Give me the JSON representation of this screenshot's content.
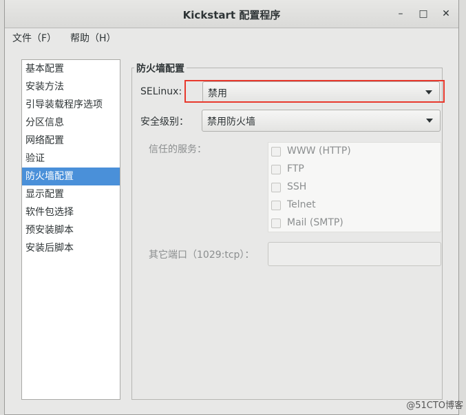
{
  "window": {
    "title": "Kickstart 配置程序",
    "controls": {
      "minimize": "–",
      "maximize": "□",
      "close": "✕"
    }
  },
  "menubar": {
    "items": [
      "文件（F）",
      "帮助（H）"
    ]
  },
  "sidebar": {
    "items": [
      "基本配置",
      "安装方法",
      "引导装载程序选项",
      "分区信息",
      "网络配置",
      "验证",
      "防火墙配置",
      "显示配置",
      "软件包选择",
      "预安装脚本",
      "安装后脚本"
    ],
    "active_index": 6
  },
  "firewall": {
    "section_title": "防火墙配置",
    "selinux": {
      "label": "SELinux:",
      "value": "禁用"
    },
    "security_level": {
      "label": "安全级别：",
      "value": "禁用防火墙"
    },
    "trusted_services": {
      "label": "信任的服务：",
      "items": [
        {
          "label": "WWW (HTTP)",
          "checked": false
        },
        {
          "label": "FTP",
          "checked": false
        },
        {
          "label": "SSH",
          "checked": false
        },
        {
          "label": "Telnet",
          "checked": false
        },
        {
          "label": "Mail (SMTP)",
          "checked": false
        }
      ]
    },
    "other_ports": {
      "label": "其它端口（1029:tcp）：",
      "value": ""
    }
  },
  "watermark": "@51CTO博客",
  "colors": {
    "selection": "#4a90d9",
    "highlight_box": "#e8382c"
  }
}
